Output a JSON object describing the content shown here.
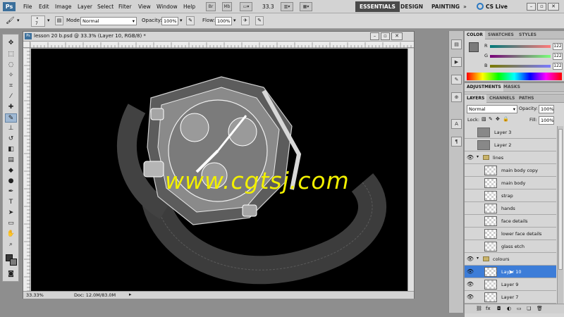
{
  "app": {
    "logo": "Ps"
  },
  "menu": [
    "File",
    "Edit",
    "Image",
    "Layer",
    "Select",
    "Filter",
    "View",
    "Window",
    "Help"
  ],
  "menu_icons": {
    "br": "Br",
    "mb": "Mb",
    "zoom": "33.3"
  },
  "workspaces": [
    "ESSENTIALS",
    "DESIGN",
    "PAINTING"
  ],
  "cslive": "CS Live",
  "options": {
    "brush_size": "7",
    "mode_label": "Mode:",
    "mode_value": "Normal",
    "opacity_label": "Opacity:",
    "opacity_value": "100%",
    "flow_label": "Flow:",
    "flow_value": "100%"
  },
  "document": {
    "title": "lesson 20 b.psd @ 33.3% (Layer 10, RGB/8) *",
    "zoom": "33.33%",
    "doc_size": "Doc: 12.0M/83.0M",
    "watermark": "www.cgtsj.com"
  },
  "color_panel": {
    "tabs": [
      "COLOR",
      "SWATCHES",
      "STYLES"
    ],
    "r_label": "R",
    "g_label": "G",
    "b_label": "B",
    "r": "122",
    "g": "122",
    "b": "122"
  },
  "adjustments_tabs": [
    "ADJUSTMENTS",
    "MASKS"
  ],
  "layers_panel": {
    "tabs": [
      "LAYERS",
      "CHANNELS",
      "PATHS"
    ],
    "blend_mode": "Normal",
    "opacity_label": "Opacity:",
    "opacity_value": "100%",
    "lock_label": "Lock:",
    "fill_label": "Fill:",
    "fill_value": "100%",
    "layers": [
      {
        "name": "Layer 3"
      },
      {
        "name": "Layer 2"
      },
      {
        "name": "lines"
      },
      {
        "name": "main body copy"
      },
      {
        "name": "main body"
      },
      {
        "name": "strap"
      },
      {
        "name": "hands"
      },
      {
        "name": "face details"
      },
      {
        "name": "lower face details"
      },
      {
        "name": "glass etch"
      },
      {
        "name": "colours"
      },
      {
        "name": "Layer 10"
      },
      {
        "name": "Layer 9"
      },
      {
        "name": "Layer 7"
      }
    ]
  },
  "colors": {
    "accent": "#3d7dd8",
    "watermark": "#f2f000"
  }
}
